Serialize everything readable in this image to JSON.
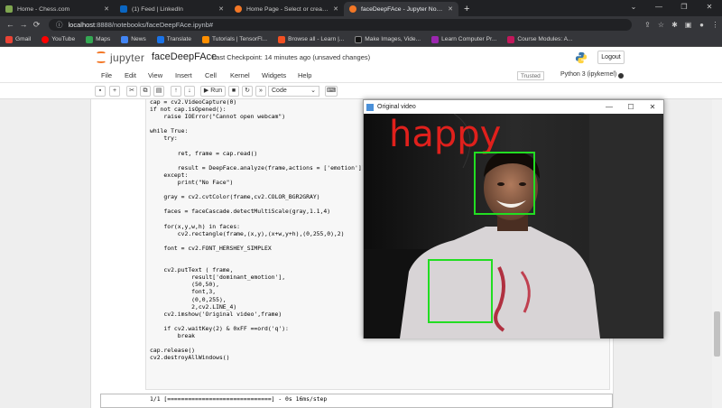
{
  "browser": {
    "tabs": [
      {
        "label": "Home - Chess.com",
        "color": "#7fa650"
      },
      {
        "label": "(1) Feed | LinkedIn",
        "color": "#0a66c2"
      },
      {
        "label": "Home Page - Select or create a n",
        "color": "#f37726"
      },
      {
        "label": "faceDeepFAce - Jupyter Notebook",
        "color": "#f37726"
      }
    ],
    "url_host": "localhost",
    "url_path": ":8888/notebooks/faceDeepFAce.ipynb#",
    "bookmarks": [
      "Gmail",
      "YouTube",
      "Maps",
      "News",
      "Translate",
      "Tutorials | TensorFl...",
      "Browse all - Learn |...",
      "Make Images, Vide...",
      "Learn Computer Pr...",
      "Course Modules: A..."
    ]
  },
  "jupyter": {
    "logo_text": "jupyter",
    "notebook_name": "faceDeepFAce",
    "checkpoint": "Last Checkpoint: 14 minutes ago",
    "changes": "(unsaved changes)",
    "logout": "Logout",
    "menu": [
      "File",
      "Edit",
      "View",
      "Insert",
      "Cell",
      "Kernel",
      "Widgets",
      "Help"
    ],
    "trusted": "Trusted",
    "kernel_name": "Python 3 (ipykernel)",
    "run_label": "Run",
    "cell_type": "Code"
  },
  "code_lines": [
    "cap = cv2.VideoCapture(0)",
    "if not cap.isOpened():",
    "    raise IOError(\"Cannot open webcam\")",
    "",
    "while True:",
    "    try:",
    "",
    "        ret, frame = cap.read()",
    "",
    "        result = DeepFace.analyze(frame,actions = ['emotion'])",
    "    except:",
    "        print(\"No Face\")",
    "",
    "    gray = cv2.cvtColor(frame,cv2.COLOR_BGR2GRAY)",
    "",
    "    faces = faceCascade.detectMultiScale(gray,1.1,4)",
    "",
    "    for(x,y,w,h) in faces:",
    "        cv2.rectangle(frame,(x,y),(x+w,y+h),(0,255,0),2)",
    "",
    "    font = cv2.FONT_HERSHEY_SIMPLEX",
    "",
    "",
    "    cv2.putText ( frame,",
    "            result['dominant_emotion'],",
    "            (50,50),",
    "            font,3,",
    "            (0,0,255),",
    "            2,cv2.LINE_4)",
    "    cv2.imshow('Original video',frame)",
    "",
    "    if cv2.waitKey(2) & 0xFF ==ord('q'):",
    "        break",
    "",
    "cap.release()",
    "cv2.destroyAllWindows()"
  ],
  "output_line": "1/1 [==============================] - 0s 16ms/step",
  "video_window": {
    "title": "Original video",
    "emotion_text": "happy",
    "emotion_color": "#e0201c",
    "box_color": "#22dd22"
  }
}
